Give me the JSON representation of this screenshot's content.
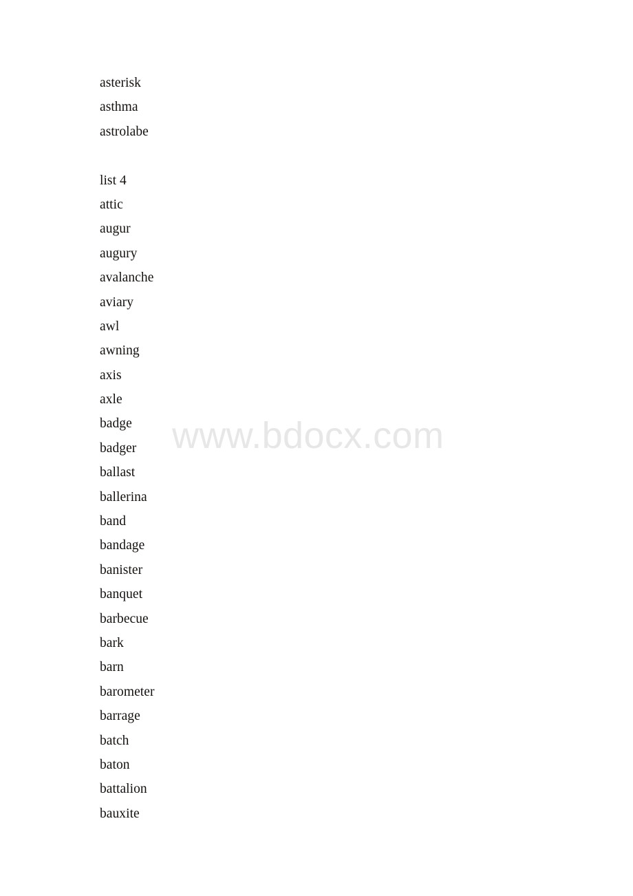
{
  "document": {
    "background_color": "#ffffff",
    "text_color": "#14110f",
    "watermark": {
      "text": "www.bdocx.com",
      "color": "#e7e7e7"
    },
    "lines": [
      {
        "text": "asterisk",
        "kind": "word"
      },
      {
        "text": "asthma",
        "kind": "word"
      },
      {
        "text": "astrolabe",
        "kind": "word"
      },
      {
        "text": "",
        "kind": "blank"
      },
      {
        "text": "list 4",
        "kind": "heading"
      },
      {
        "text": "attic",
        "kind": "word"
      },
      {
        "text": "augur",
        "kind": "word"
      },
      {
        "text": "augury",
        "kind": "word"
      },
      {
        "text": "avalanche",
        "kind": "word"
      },
      {
        "text": "aviary",
        "kind": "word"
      },
      {
        "text": "awl",
        "kind": "word"
      },
      {
        "text": "awning",
        "kind": "word"
      },
      {
        "text": "axis",
        "kind": "word"
      },
      {
        "text": "axle",
        "kind": "word"
      },
      {
        "text": "badge",
        "kind": "word"
      },
      {
        "text": "badger",
        "kind": "word"
      },
      {
        "text": "ballast",
        "kind": "word"
      },
      {
        "text": "ballerina",
        "kind": "word"
      },
      {
        "text": "band",
        "kind": "word"
      },
      {
        "text": "bandage",
        "kind": "word"
      },
      {
        "text": "banister",
        "kind": "word"
      },
      {
        "text": "banquet",
        "kind": "word"
      },
      {
        "text": "barbecue",
        "kind": "word"
      },
      {
        "text": "bark",
        "kind": "word"
      },
      {
        "text": "barn",
        "kind": "word"
      },
      {
        "text": "barometer",
        "kind": "word"
      },
      {
        "text": "barrage",
        "kind": "word"
      },
      {
        "text": "batch",
        "kind": "word"
      },
      {
        "text": "baton",
        "kind": "word"
      },
      {
        "text": "battalion",
        "kind": "word"
      },
      {
        "text": "bauxite",
        "kind": "word"
      }
    ]
  }
}
